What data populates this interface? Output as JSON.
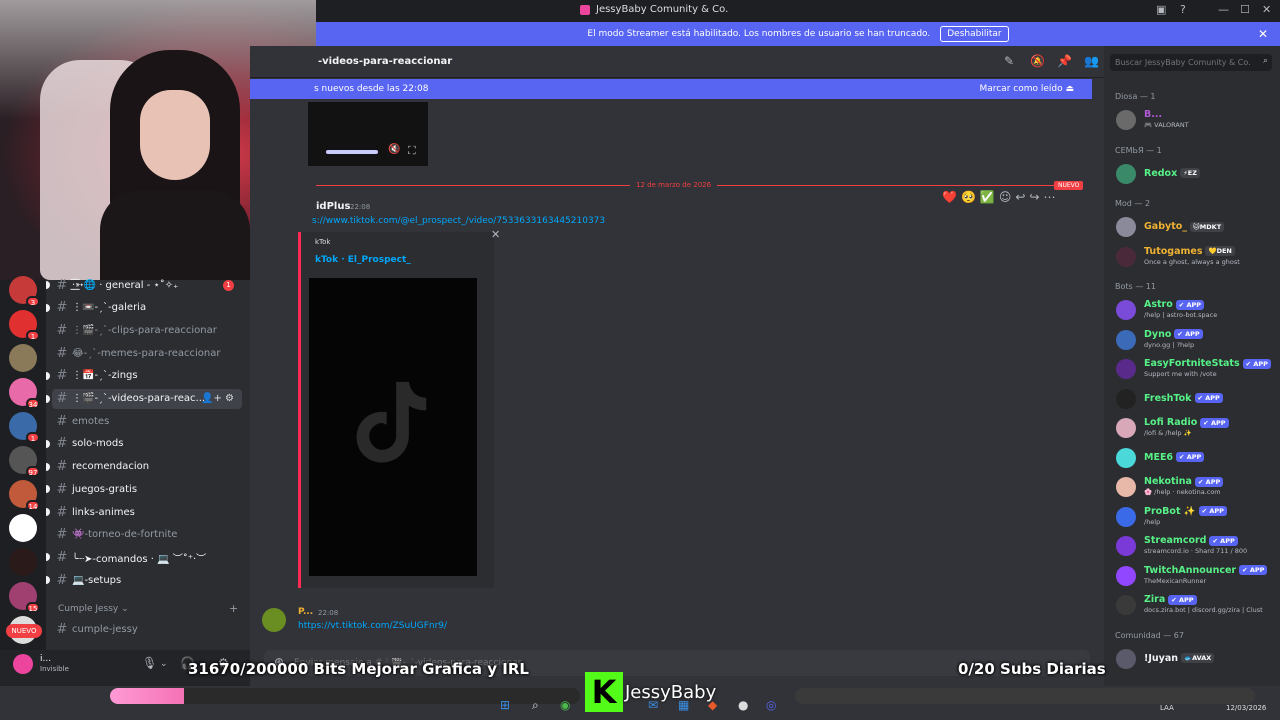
{
  "window": {
    "title": "JessyBaby Comunity & Co."
  },
  "banner": {
    "text": "El modo Streamer está habilitado. Los nombres de usuario se han truncado.",
    "button": "Deshabilitar"
  },
  "servers": [
    {
      "badge": "3",
      "color": "#c73a3a"
    },
    {
      "badge": "1",
      "color": "#e03030"
    },
    {
      "badge": "",
      "color": "#8a7a5a"
    },
    {
      "badge": "34",
      "color": "#e86aa8"
    },
    {
      "badge": "1",
      "color": "#3a6aa8"
    },
    {
      "badge": "97",
      "color": "#555555"
    },
    {
      "badge": "14",
      "color": "#c05a3a"
    },
    {
      "badge": "",
      "color": "#ffffff"
    },
    {
      "badge": "",
      "color": "#2a1a1a"
    },
    {
      "badge": "15",
      "color": "#a04070"
    },
    {
      "badge": "",
      "color": "#dddddd"
    }
  ],
  "rail_new": "NUEVO",
  "channels": [
    {
      "name": "·͟͟͞͞➳🌐 · general - ⋆˚✧₊",
      "unread": true,
      "badge": "1"
    },
    {
      "name": "⋮📼-ˏˋ-galeria",
      "unread": true,
      "badge": ""
    },
    {
      "name": "⋮🎬-ˏˋ-clips-para-reaccionar",
      "unread": false,
      "badge": ""
    },
    {
      "name": "😂-ˏˋ-memes-para-reaccionar",
      "unread": false,
      "badge": ""
    },
    {
      "name": "⋮📅-ˏˋ-zings",
      "unread": true,
      "badge": ""
    },
    {
      "name": "⋮🎬-ˏˋ-videos-para-reac...",
      "unread": true,
      "badge": "",
      "active": true
    },
    {
      "name": "emotes",
      "unread": false,
      "badge": ""
    },
    {
      "name": "solo-mods",
      "unread": true,
      "badge": ""
    },
    {
      "name": "recomendacion",
      "unread": true,
      "badge": ""
    },
    {
      "name": "juegos-gratis",
      "unread": true,
      "badge": ""
    },
    {
      "name": "links-animes",
      "unread": true,
      "badge": ""
    },
    {
      "name": "👾-torneo-de-fortnite",
      "unread": false,
      "badge": ""
    },
    {
      "name": "╰┈➤-comandos · 💻 ︶˚⁺‧︶",
      "unread": true,
      "badge": ""
    },
    {
      "name": "💻-setups",
      "unread": true,
      "badge": ""
    }
  ],
  "category": {
    "name": "Cumple Jessy ⌄",
    "plus": "+"
  },
  "category_channel": "cumple-jessy",
  "user": {
    "name": "i...",
    "status": "Invisible"
  },
  "chat": {
    "channel_title": "-videos-para-reaccionar",
    "new_since": "s nuevos desde las 22:08",
    "mark_read": "Marcar como leído",
    "date_divider": "12 de marzo de 2026",
    "new_label": "NUEVO",
    "msg1": {
      "author": "idPlus",
      "time": "22:08",
      "link": "s://www.tiktok.com/@el_prospect_/video/7533633163445210373",
      "embed_provider": "kTok",
      "embed_title": "kTok · El_Prospect_"
    },
    "msg2": {
      "author": "P...",
      "time": "22:08",
      "link": "https://vt.tiktok.com/ZSuUGFnr9/"
    },
    "composer_placeholder": "Enviar mensaje a #⋮🎬-ˏˋ-videos-para-reaccionar"
  },
  "members": {
    "search_placeholder": "Buscar JessyBaby Comunity & Co.",
    "groups": [
      {
        "title": "Diosa — 1",
        "items": [
          {
            "name": "B...",
            "sub": "🎮 VALORANT",
            "color": "#b05ad8",
            "tag": "",
            "avatar": "#6a6a6a"
          }
        ]
      },
      {
        "title": "СЕМЬЯ — 1",
        "items": [
          {
            "name": "Redox",
            "sub": "",
            "color": "#57f287",
            "tag": "⚡EZ",
            "avatar": "#3a8a6a"
          }
        ]
      },
      {
        "title": "Mod — 2",
        "items": [
          {
            "name": "Gabyto_",
            "sub": "",
            "color": "#f0b232",
            "tag": "🐱MDKT",
            "avatar": "#8a8a9a"
          },
          {
            "name": "Tutogames",
            "sub": "Once a ghost, always a ghost",
            "color": "#f0b232",
            "tag": "💛DEN",
            "avatar": "#4a2a3a"
          }
        ]
      },
      {
        "title": "Bots — 11",
        "items": [
          {
            "name": "Astro",
            "sub": "/help | astro-bot.space",
            "color": "#57f287",
            "tag": "✔ APP",
            "avatar": "#7a4ad8"
          },
          {
            "name": "Dyno",
            "sub": "dyno.gg | ?help",
            "color": "#57f287",
            "tag": "✔ APP",
            "avatar": "#3a6ab8"
          },
          {
            "name": "EasyFortniteStats",
            "sub": "Support me with /vote",
            "color": "#57f287",
            "tag": "✔ APP",
            "avatar": "#5a2a8a"
          },
          {
            "name": "FreshTok",
            "sub": "",
            "color": "#57f287",
            "tag": "✔ APP",
            "avatar": "#222222"
          },
          {
            "name": "Lofi Radio",
            "sub": "/lofi & /help ✨",
            "color": "#57f287",
            "tag": "✔ APP",
            "avatar": "#d8a8b8"
          },
          {
            "name": "MEE6",
            "sub": "",
            "color": "#57f287",
            "tag": "✔ APP",
            "avatar": "#4ad8d8"
          },
          {
            "name": "Nekotina",
            "sub": "🌸 /help · nekotina.com",
            "color": "#57f287",
            "tag": "✔ APP",
            "avatar": "#e8b8a8"
          },
          {
            "name": "ProBot ✨",
            "sub": "/help",
            "color": "#57f287",
            "tag": "✔ APP",
            "avatar": "#3a6ae8"
          },
          {
            "name": "Streamcord",
            "sub": "streamcord.io · Shard 711 / 800",
            "color": "#57f287",
            "tag": "✔ APP",
            "avatar": "#7a3ad8"
          },
          {
            "name": "TwitchAnnouncer",
            "sub": "TheMexicanRunner",
            "color": "#57f287",
            "tag": "✔ APP",
            "avatar": "#9146ff"
          },
          {
            "name": "Zira",
            "sub": "docs.zira.bot | discord.gg/zira | Clust",
            "color": "#57f287",
            "tag": "✔ APP",
            "avatar": "#3a3a3a"
          }
        ]
      },
      {
        "title": "Comunidad — 67",
        "items": [
          {
            "name": "!Juyan",
            "sub": "",
            "color": "#f2f3f5",
            "tag": "🐟AVAX",
            "avatar": "#5a5a6a"
          }
        ]
      }
    ]
  },
  "overlay": {
    "bits_text": "31670/200000 Bits Mejorar Grafica y IRL",
    "bits_progress": 0.158,
    "subs_text": "0/20 Subs Diarias",
    "subs_progress": 0.0,
    "brand": "JessyBaby",
    "brand_letter": "K"
  },
  "taskbar": {
    "lang": "LAA",
    "date": "12/03/2026"
  }
}
